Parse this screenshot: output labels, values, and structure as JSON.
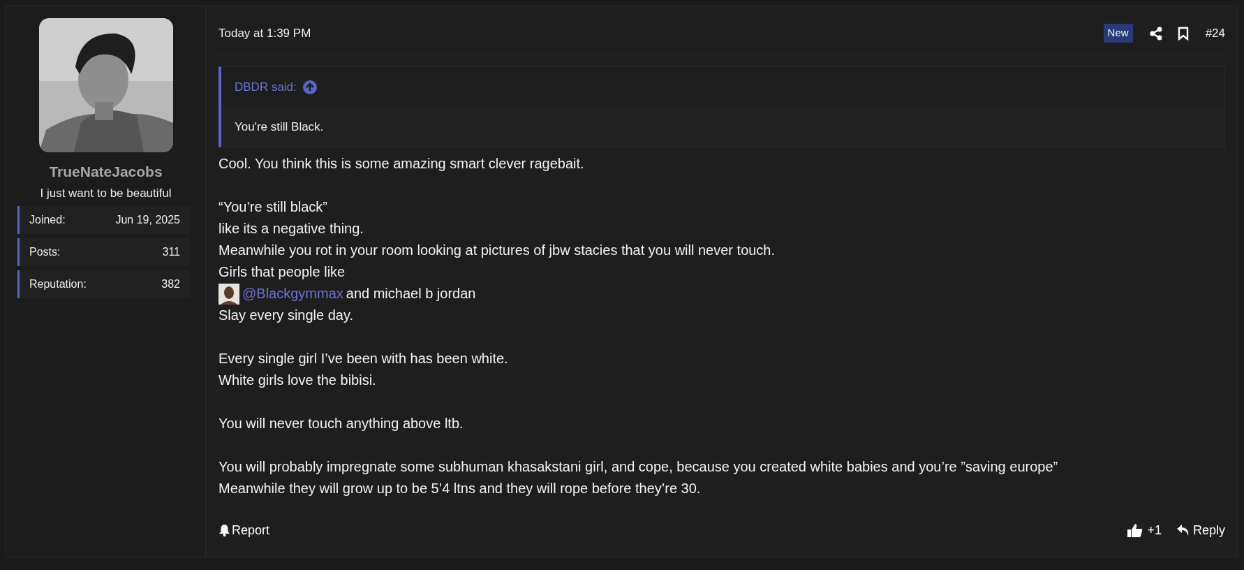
{
  "user": {
    "name": "TrueNateJacobs",
    "title": "I just want to be beautiful",
    "stats": [
      {
        "label": "Joined:",
        "value": "Jun 19, 2025"
      },
      {
        "label": "Posts:",
        "value": "311"
      },
      {
        "label": "Reputation:",
        "value": "382"
      }
    ]
  },
  "post": {
    "time": "Today at 1:39 PM",
    "badge": "New",
    "number": "#24",
    "quote": {
      "author": "DBDR said:",
      "text": "You're still Black."
    },
    "paragraphs": [
      [
        {
          "kind": "text",
          "text": "Cool. You think this is some amazing smart clever ragebait."
        }
      ],
      [
        {
          "kind": "text",
          "text": "“You’re still black”"
        },
        {
          "kind": "text",
          "text": "like its a negative thing."
        },
        {
          "kind": "text",
          "text": "Meanwhile you rot in your room looking at pictures of jbw stacies that you will never touch."
        },
        {
          "kind": "text",
          "text": "Girls that people like"
        },
        {
          "kind": "mention",
          "mention": "@Blackgymmax",
          "text": "and michael b jordan"
        },
        {
          "kind": "text",
          "text": "Slay every single day."
        }
      ],
      [
        {
          "kind": "text",
          "text": "Every single girl I’ve been with has been white."
        },
        {
          "kind": "text",
          "text": "White girls love the bibisi."
        }
      ],
      [
        {
          "kind": "text",
          "text": "You will never touch anything above ltb."
        }
      ],
      [
        {
          "kind": "text",
          "text": "You will probably impregnate some subhuman khasakstani girl, and cope, because you created white babies and you’re ”saving europe”"
        },
        {
          "kind": "text",
          "text": "Meanwhile they will grow up to be 5’4 ltns and they will rope before they’re 30."
        }
      ]
    ],
    "report": "Report",
    "likes": "+1",
    "reply": "Reply"
  }
}
